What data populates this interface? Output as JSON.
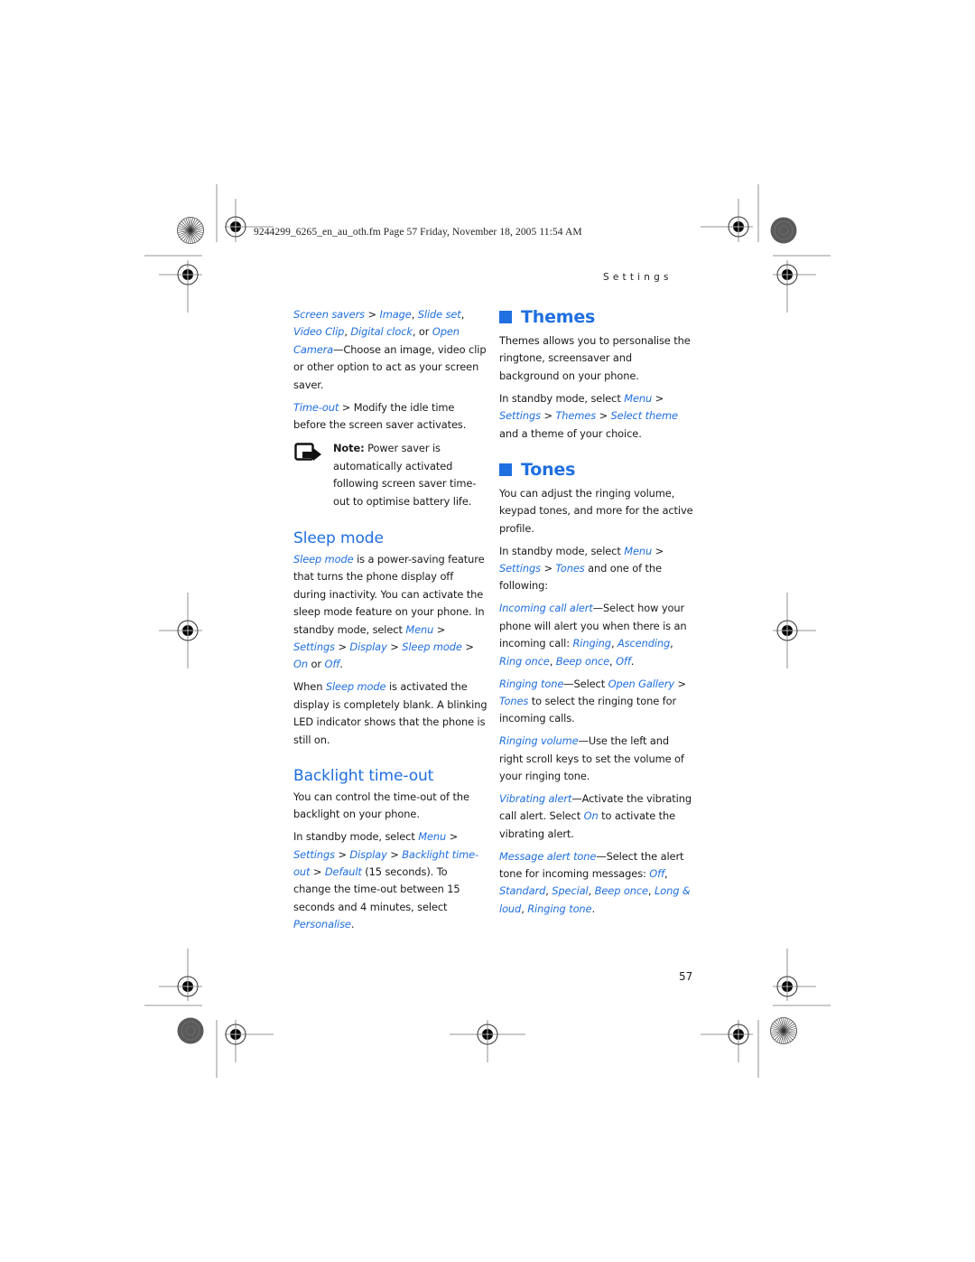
{
  "slug": "9244299_6265_en_au_oth.fm  Page 57  Friday, November 18, 2005  11:54 AM",
  "running_header": "Settings",
  "page_number": "57",
  "colors": {
    "accent": "#1f6fe0",
    "text": "#1a1a1a"
  },
  "left": {
    "screen_savers": {
      "path": [
        "Screen savers",
        " > ",
        "Image",
        ", ",
        "Slide set",
        ", ",
        "Video Clip",
        ", ",
        "Digital clock",
        ", or ",
        "Open Camera"
      ],
      "desc": "—Choose an image, video clip or other option to act as your screen saver."
    },
    "timeout": {
      "link": "Time-out",
      "text": " > Modify the idle time before the screen saver activates."
    },
    "note": {
      "icon": "note-icon",
      "label": "Note:",
      "text": " Power saver is automatically activated following screen saver time-out to optimise battery life."
    },
    "sleep_mode": {
      "heading": "Sleep mode",
      "p1": {
        "link": "Sleep mode",
        "text": " is a power-saving feature that turns the phone display off during inactivity. You can activate the sleep mode feature on your phone. In standby mode, select ",
        "menu": "Menu",
        "settings": "Settings",
        "display": "Display",
        "sleep": "Sleep mode",
        "on": "On",
        "or": " or ",
        "off": "Off"
      },
      "p2": {
        "pre": "When ",
        "link": "Sleep mode",
        "text": " is activated the display is completely blank. A blinking LED indicator shows that the phone is still on."
      }
    },
    "backlight": {
      "heading": "Backlight time-out",
      "p1": "You can control the time-out of the backlight on your phone.",
      "p2": {
        "pre": "In standby mode, select ",
        "menu": "Menu",
        "settings": "Settings",
        "display": "Display",
        "backlight": "Backlight time-out",
        "default": "Default",
        "mid": " (15 seconds). To change the time-out between 15 seconds and 4 minutes, select ",
        "personalise": "Personalise"
      }
    }
  },
  "right": {
    "themes": {
      "heading": "Themes",
      "p1": "Themes allows you to personalise the ringtone, screensaver and background on your phone.",
      "p2": {
        "pre": "In standby mode, select ",
        "menu": "Menu",
        "settings": "Settings",
        "themes": "Themes",
        "select": "Select theme",
        "post": " and a theme of your choice."
      }
    },
    "tones": {
      "heading": "Tones",
      "p1": "You can adjust the ringing volume, keypad tones, and more for the active profile.",
      "p2": {
        "pre": "In standby mode, select ",
        "menu": "Menu",
        "settings": "Settings",
        "tones": "Tones",
        "post": " and one of the following:"
      },
      "items": {
        "incoming": {
          "link": "Incoming call alert",
          "text": "—Select how your phone will alert you when there is an incoming call: ",
          "options": [
            "Ringing",
            "Ascending",
            "Ring once",
            "Beep once",
            "Off"
          ]
        },
        "ringing_tone": {
          "link": "Ringing tone",
          "text": "—Select ",
          "gallery": "Open Gallery",
          "tones": "Tones",
          "post": " to select the ringing tone for incoming calls."
        },
        "volume": {
          "link": "Ringing volume",
          "text": "—Use the left and right scroll keys to set the volume of your ringing tone."
        },
        "vibrating": {
          "link": "Vibrating alert",
          "text": "—Activate the vibrating call alert. Select ",
          "on": "On",
          "post": " to activate the vibrating alert."
        },
        "message": {
          "link": "Message alert tone",
          "text": "—Select the alert tone for incoming messages: ",
          "options": [
            "Off",
            "Standard",
            "Special",
            "Beep once",
            "Long & loud",
            "Ringing tone"
          ]
        }
      }
    }
  }
}
